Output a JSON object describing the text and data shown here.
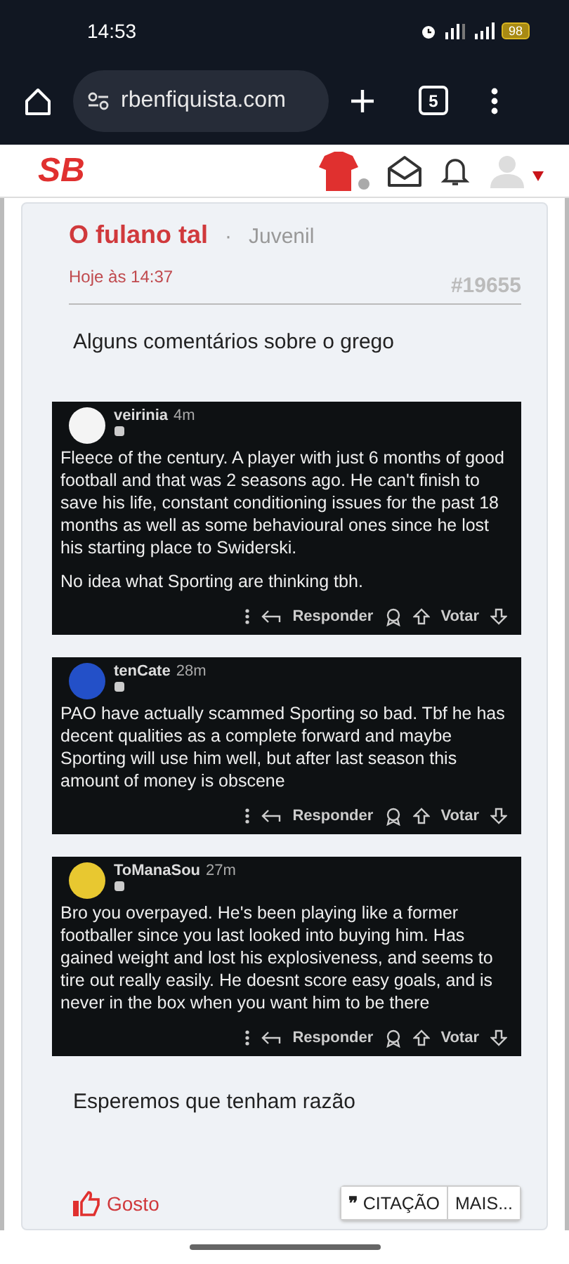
{
  "status_bar": {
    "time": "14:53",
    "battery": "98"
  },
  "browser": {
    "url": "rbenfiquista.com",
    "tab_count": "5"
  },
  "site_header": {
    "logo": "SB"
  },
  "post": {
    "author": "O fulano tal",
    "separator": "·",
    "rank": "Juvenil",
    "date": "Hoje às 14:37",
    "number": "#19655",
    "intro": "Alguns comentários sobre o grego",
    "comments": [
      {
        "user": "veirinia",
        "age": "4m",
        "color": "#f4f4f4",
        "paragraphs": [
          "Fleece of the century. A player with just 6 months of good football and that was 2 seasons ago. He can't finish to save his life, constant conditioning issues for the past 18 months as well as some behavioural ones since he lost his starting place to Swiderski.",
          "No idea what Sporting are thinking tbh."
        ],
        "reply": "Responder",
        "vote": "Votar"
      },
      {
        "user": "tenCate",
        "age": "28m",
        "color": "#2350c8",
        "paragraphs": [
          "PAO have actually scammed Sporting so bad. Tbf he has decent qualities as a complete forward and maybe Sporting will use him well, but after last season this amount of money is obscene"
        ],
        "reply": "Responder",
        "vote": "Votar"
      },
      {
        "user": "ToManaSou",
        "age": "27m",
        "color": "#e8c830",
        "paragraphs": [
          "Bro you overpayed. He's been playing like a former footballer since you last looked into buying him. Has gained weight and lost his explosiveness, and seems to tire out really easily. He doesnt score easy goals, and is never in the box when you want him to be there"
        ],
        "reply": "Responder",
        "vote": "Votar"
      }
    ],
    "outro": "Esperemos que tenham razão",
    "like": "Gosto",
    "quote_icon": "❞",
    "quote": "CITAÇÃO",
    "more": "MAIS..."
  }
}
